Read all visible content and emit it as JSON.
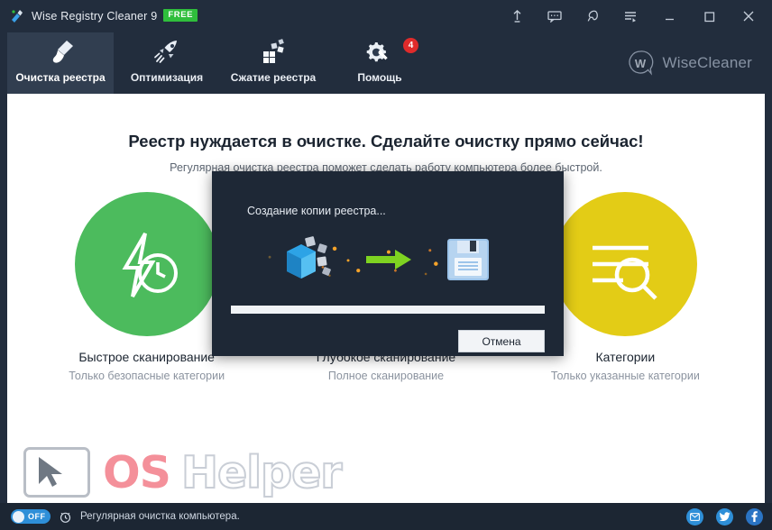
{
  "window": {
    "title": "Wise Registry Cleaner 9",
    "edition_badge": "FREE",
    "app_icon_name": "wise-registry-cleaner-icon"
  },
  "titlebar_buttons": [
    {
      "name": "upgrade-icon",
      "tooltip": "Upgrade"
    },
    {
      "name": "feedback-icon",
      "tooltip": "Feedback"
    },
    {
      "name": "theme-icon",
      "tooltip": "Theme"
    },
    {
      "name": "menu-icon",
      "tooltip": "Menu"
    },
    {
      "name": "minimize-icon",
      "tooltip": "Minimize"
    },
    {
      "name": "maximize-icon",
      "tooltip": "Maximize"
    },
    {
      "name": "close-icon",
      "tooltip": "Close"
    }
  ],
  "nav": {
    "tabs": [
      {
        "label": "Очистка реестра",
        "icon": "brush-icon",
        "active": true,
        "badge": ""
      },
      {
        "label": "Оптимизация",
        "icon": "rocket-icon",
        "active": false,
        "badge": ""
      },
      {
        "label": "Сжатие реестра",
        "icon": "blocks-icon",
        "active": false,
        "badge": ""
      },
      {
        "label": "Помощь",
        "icon": "gear-wrench-icon",
        "active": false,
        "badge": "4"
      }
    ],
    "brand": "WiseCleaner",
    "brand_mark": "W"
  },
  "main": {
    "headline": "Реестр нуждается в очистке. Сделайте очистку прямо сейчас!",
    "subhead": "Регулярная очистка реестра поможет сделать работу компьютера более быстрой.",
    "options": [
      {
        "title": "Быстрое сканирование",
        "subtitle": "Только безопасные категории",
        "color": "#4cbb5d",
        "icon": "lightning-clock-icon"
      },
      {
        "title": "Глубокое сканирование",
        "subtitle": "Полное сканирование",
        "color": "#3a9fe0",
        "icon": "magnifier-deep-icon"
      },
      {
        "title": "Категории",
        "subtitle": "Только указанные категории",
        "color": "#e3cc16",
        "icon": "list-search-icon"
      }
    ]
  },
  "modal": {
    "title": "Создание копии реестра...",
    "cancel_label": "Отмена",
    "progress_percent": 100,
    "icons": {
      "source": "registry-cube-icon",
      "arrow": "green-arrow-icon",
      "target": "floppy-save-icon"
    }
  },
  "watermark": {
    "part1": "OS",
    "part2": "Helper",
    "cursor_icon": "cursor-screen-icon"
  },
  "statusbar": {
    "toggle_label": "OFF",
    "toggle_on": false,
    "clock_icon": "alarm-clock-icon",
    "text": "Регулярная очистка компьютера.",
    "social": [
      {
        "name": "email-icon",
        "glyph": "✉"
      },
      {
        "name": "twitter-icon",
        "glyph": "t"
      },
      {
        "name": "facebook-icon",
        "glyph": "f"
      }
    ]
  },
  "colors": {
    "chrome": "#222d3d",
    "chrome_dark": "#1c2633",
    "active_tab": "#313e50",
    "accent_green": "#2fbe3c",
    "badge_red": "#e02b2b",
    "toggle_blue": "#2e8fd8"
  }
}
